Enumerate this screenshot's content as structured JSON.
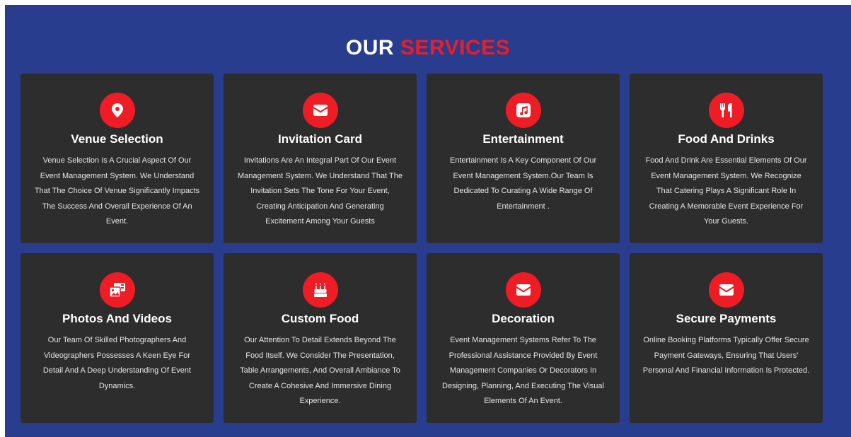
{
  "heading": {
    "part1": "OUR",
    "part2": "SERVICES"
  },
  "colors": {
    "background": "#283d8e",
    "accent": "#ee1c25",
    "card": "#2d2d2d",
    "text": "#ffffff"
  },
  "services": [
    {
      "title": "Venue Selection",
      "icon": "map-marker-icon",
      "description": "Venue Selection Is A Crucial Aspect Of Our Event Management System. We Understand That The Choice Of Venue Significantly Impacts The Success And Overall Experience Of An Event."
    },
    {
      "title": "Invitation Card",
      "icon": "envelope-icon",
      "description": "Invitations Are An Integral Part Of Our Event Management System. We Understand That The Invitation Sets The Tone For Your Event, Creating Anticipation And Generating Excitement Among Your Guests"
    },
    {
      "title": "Entertainment",
      "icon": "music-icon",
      "description": "Entertainment Is A Key Component Of Our Event Management System.Our Team Is Dedicated To Curating A Wide Range Of Entertainment ."
    },
    {
      "title": "Food And Drinks",
      "icon": "utensils-icon",
      "description": "Food And Drink Are Essential Elements Of Our Event Management System. We Recognize That Catering Plays A Significant Role In Creating A Memorable Event Experience For Your Guests."
    },
    {
      "title": "Photos And Videos",
      "icon": "photo-video-icon",
      "description": "Our Team Of Skilled Photographers And Videographers Possesses A Keen Eye For Detail And A Deep Understanding Of Event Dynamics."
    },
    {
      "title": "Custom Food",
      "icon": "birthday-cake-icon",
      "description": "Our Attention To Detail Extends Beyond The Food Itself. We Consider The Presentation, Table Arrangements, And Overall Ambiance To Create A Cohesive And Immersive Dining Experience."
    },
    {
      "title": "Decoration",
      "icon": "envelope-icon",
      "description": "Event Management Systems Refer To The Professional Assistance Provided By Event Management Companies Or Decorators In Designing, Planning, And Executing The Visual Elements Of An Event."
    },
    {
      "title": "Secure Payments",
      "icon": "envelope-icon",
      "description": "Online Booking Platforms Typically Offer Secure Payment Gateways, Ensuring That Users' Personal And Financial Information Is Protected."
    }
  ]
}
